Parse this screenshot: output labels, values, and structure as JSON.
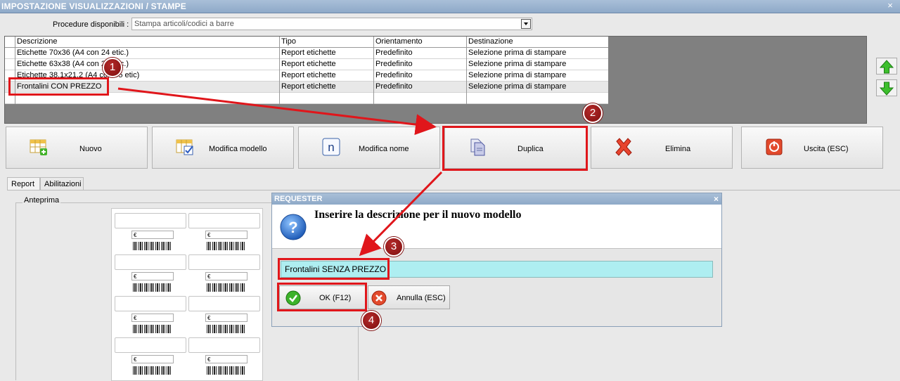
{
  "window": {
    "title": "IMPOSTAZIONE VISUALIZZAZIONI / STAMPE",
    "close": "×"
  },
  "procedure": {
    "label": "Procedure disponibili :",
    "value": "Stampa articoli/codici a barre"
  },
  "grid": {
    "columns": [
      "Descrizione",
      "Tipo",
      "Orientamento",
      "Destinazione"
    ],
    "rows": [
      [
        "Etichette 70x36 (A4 con 24 etic.)",
        "Report etichette",
        "Predefinito",
        "Selezione prima di stampare"
      ],
      [
        "Etichette 63x38 (A4 con 21 etic.)",
        "Report etichette",
        "Predefinito",
        "Selezione prima di stampare"
      ],
      [
        "Etichette 38,1x21,2 (A4 con 65 etic)",
        "Report etichette",
        "Predefinito",
        "Selezione prima di stampare"
      ],
      [
        "Frontalini CON PREZZO",
        "Report etichette",
        "Predefinito",
        "Selezione prima di stampare"
      ]
    ]
  },
  "toolbar": {
    "nuovo": "Nuovo",
    "modifica_modello": "Modifica modello",
    "modifica_nome": "Modifica nome",
    "duplica": "Duplica",
    "elimina": "Elimina",
    "uscita": "Uscita (ESC)"
  },
  "tabs": {
    "report": "Report",
    "abilitazioni": "Abilitazioni"
  },
  "preview": {
    "label": "Anteprima",
    "currency": "€"
  },
  "dialog": {
    "title": "REQUESTER",
    "close": "×",
    "message": "Inserire la descrizione per il nuovo modello",
    "input_value": "Frontalini SENZA PREZZO",
    "ok": "OK (F12)",
    "cancel": "Annulla (ESC)"
  },
  "annotations": {
    "b1": "1",
    "b2": "2",
    "b3": "3",
    "b4": "4"
  },
  "colors": {
    "highlight": "#e0161b",
    "badge": "#8b1414",
    "input_bg": "#aeeef1",
    "titlebar": "#9bb3cf"
  }
}
